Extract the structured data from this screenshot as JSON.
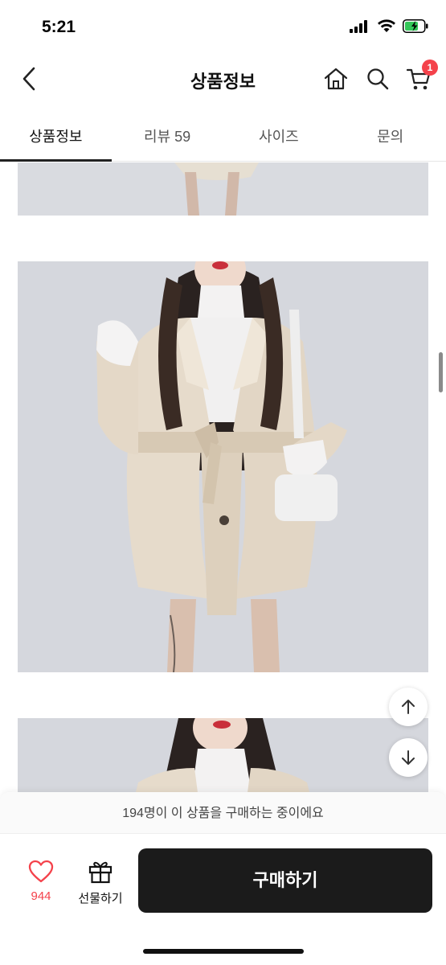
{
  "status_bar": {
    "time": "5:21"
  },
  "header": {
    "title": "상품정보",
    "cart_badge": "1"
  },
  "tabs": [
    {
      "label": "상품정보",
      "active": true
    },
    {
      "label": "리뷰 59",
      "active": false
    },
    {
      "label": "사이즈",
      "active": false
    },
    {
      "label": "문의",
      "active": false
    }
  ],
  "bottom": {
    "notice": "194명이 이 상품을 구매하는 중이에요",
    "like_count": "944",
    "gift_label": "선물하기",
    "buy_label": "구매하기"
  },
  "colors": {
    "accent": "#f4424b",
    "buy_button": "#1b1b1b",
    "image_bg": "#d6d8de"
  },
  "icons": [
    "back-icon",
    "home-icon",
    "search-icon",
    "cart-icon",
    "heart-icon",
    "gift-icon",
    "arrow-up-icon",
    "arrow-down-icon"
  ]
}
